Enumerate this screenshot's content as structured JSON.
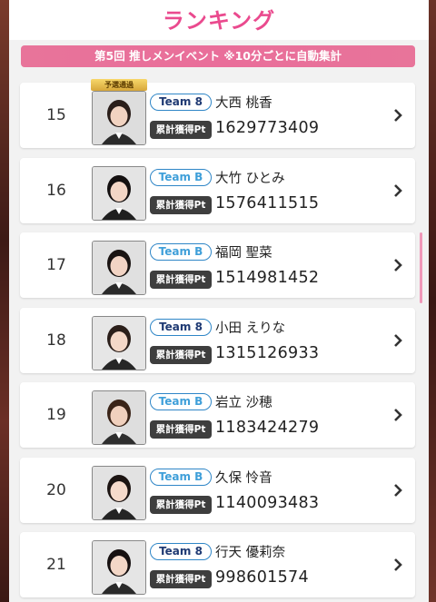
{
  "header": {
    "title": "ランキング"
  },
  "event": {
    "banner": "第5回 推しメンイベント ※10分ごとに自動集計"
  },
  "labels": {
    "cumulative_pt": "累計獲得Pt",
    "qualified_badge": "予選通過"
  },
  "colors": {
    "accent_pink": "#ea4a8e",
    "team_border": "#2f86c7",
    "pt_label_bg": "#3e3e3e"
  },
  "rows": [
    {
      "rank": "15",
      "team": "Team 8",
      "name": "大西 桃香",
      "points": "1629773409",
      "badge": "予選通過",
      "team_style": "dark"
    },
    {
      "rank": "16",
      "team": "Team B",
      "name": "大竹 ひとみ",
      "points": "1576411515",
      "team_style": "light"
    },
    {
      "rank": "17",
      "team": "Team B",
      "name": "福岡 聖菜",
      "points": "1514981452",
      "team_style": "light"
    },
    {
      "rank": "18",
      "team": "Team 8",
      "name": "小田 えりな",
      "points": "1315126933",
      "team_style": "dark"
    },
    {
      "rank": "19",
      "team": "Team B",
      "name": "岩立 沙穂",
      "points": "1183424279",
      "team_style": "light"
    },
    {
      "rank": "20",
      "team": "Team B",
      "name": "久保 怜音",
      "points": "1140093483",
      "team_style": "light"
    },
    {
      "rank": "21",
      "team": "Team 8",
      "name": "行天 優莉奈",
      "points": "998601574",
      "team_style": "dark"
    }
  ]
}
